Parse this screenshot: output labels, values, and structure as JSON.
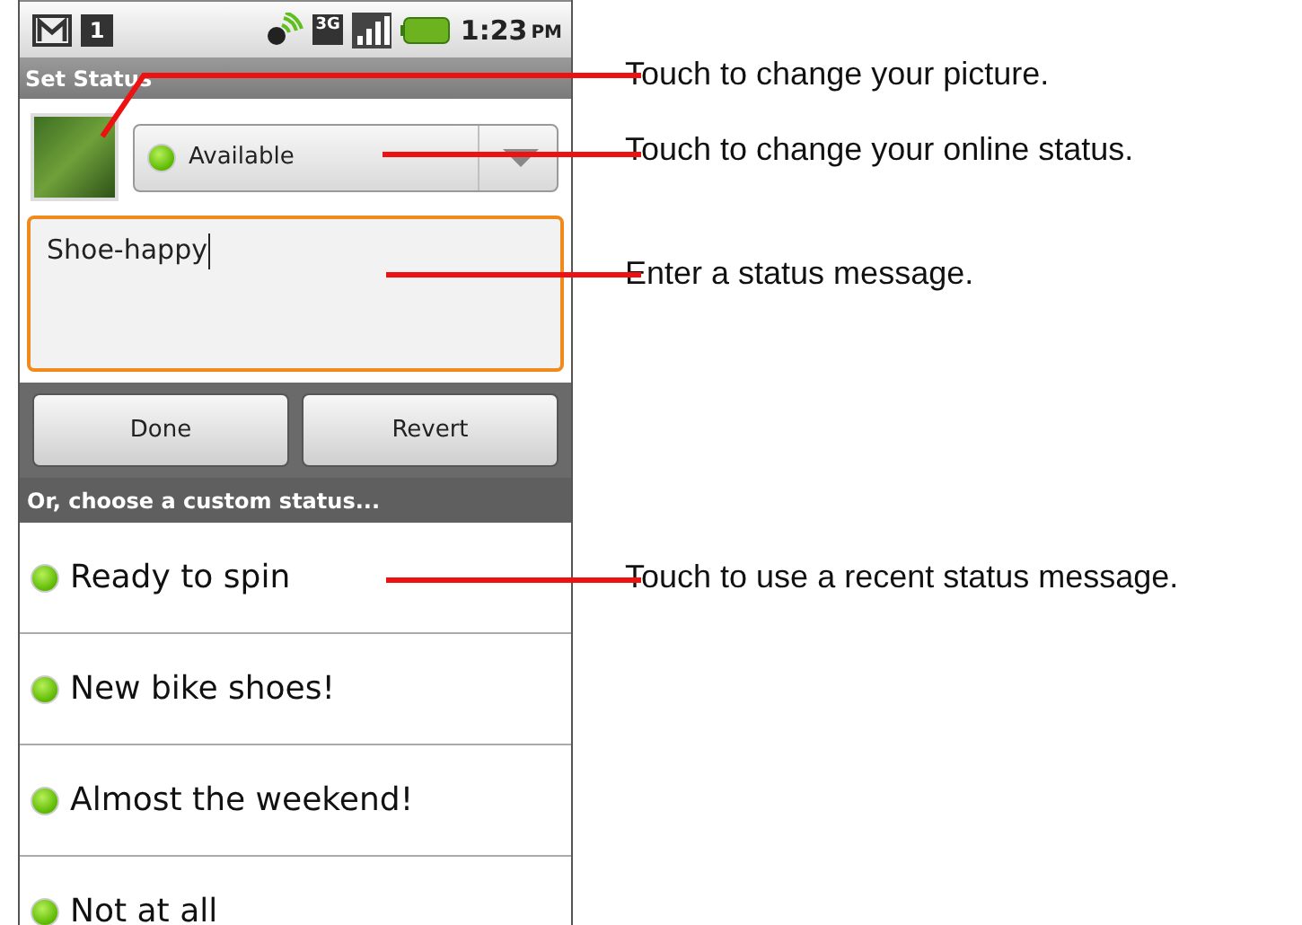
{
  "status_bar": {
    "calendar_day": "1",
    "network_type": "3G",
    "time": "1:23",
    "meridiem": "PM"
  },
  "title": "Set Status",
  "presence": {
    "label": "Available"
  },
  "message": {
    "value": "Shoe-happy",
    "focused": true
  },
  "buttons": [
    "Done",
    "Revert"
  ],
  "section_header": "Or, choose a custom status...",
  "recent_statuses": [
    {
      "label": "Ready to spin"
    },
    {
      "label": "New bike shoes!"
    },
    {
      "label": "Almost the weekend!"
    },
    {
      "label": "Not at all"
    }
  ],
  "callouts": [
    {
      "text": "Touch to change your picture."
    },
    {
      "text": "Touch to change your online status."
    },
    {
      "text": "Enter a status message."
    },
    {
      "text": "Touch to use a recent status message."
    }
  ]
}
